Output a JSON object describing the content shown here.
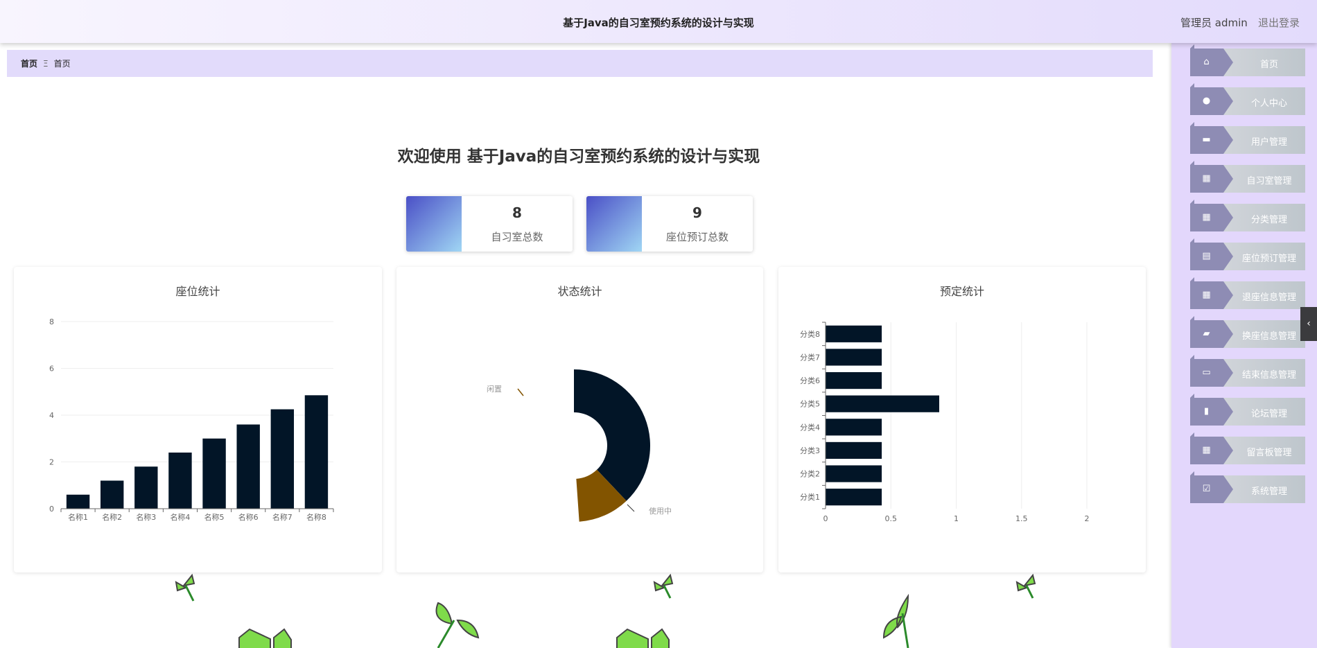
{
  "header": {
    "title": "基于Java的自习室预约系统的设计与实现",
    "user": "管理员 admin",
    "logout": "退出登录"
  },
  "breadcrumb": {
    "items": [
      "首页",
      "首页"
    ],
    "separator": "Ξ"
  },
  "welcome": "欢迎使用 基于Java的自习室预约系统的设计与实现",
  "stats": [
    {
      "value": "8",
      "label": "自习室总数"
    },
    {
      "value": "9",
      "label": "座位预订总数"
    }
  ],
  "sidebar": {
    "items": [
      {
        "label": "首页",
        "icon": "home-icon"
      },
      {
        "label": "个人中心",
        "icon": "user-icon"
      },
      {
        "label": "用户管理",
        "icon": "briefcase-icon"
      },
      {
        "label": "自习室管理",
        "icon": "grid-icon"
      },
      {
        "label": "分类管理",
        "icon": "grid-icon"
      },
      {
        "label": "座位预订管理",
        "icon": "clipboard-icon"
      },
      {
        "label": "退座信息管理",
        "icon": "table-icon"
      },
      {
        "label": "换座信息管理",
        "icon": "ticket-icon"
      },
      {
        "label": "结束信息管理",
        "icon": "chat-icon"
      },
      {
        "label": "论坛管理",
        "icon": "book-icon"
      },
      {
        "label": "留言板管理",
        "icon": "grid-icon"
      },
      {
        "label": "系统管理",
        "icon": "checklist-icon"
      }
    ],
    "collapse": "‹"
  },
  "colors": {
    "bar": "#021527",
    "brown": "#825400",
    "accent": "#8e8cb4"
  },
  "chart_data": [
    {
      "type": "bar",
      "title": "座位统计",
      "categories": [
        "名称1",
        "名称2",
        "名称3",
        "名称4",
        "名称5",
        "名称6",
        "名称7",
        "名称8"
      ],
      "values": [
        0.6,
        1.2,
        1.8,
        2.4,
        3.0,
        3.6,
        4.25,
        4.85
      ],
      "ylim": [
        0,
        8
      ],
      "yticks": [
        "0",
        "2",
        "4",
        "6",
        "8"
      ],
      "grid": true
    },
    {
      "type": "pie",
      "title": "状态统计",
      "slices": [
        {
          "name": "使用中",
          "value": 38
        },
        {
          "name": "闲置",
          "value": 11
        }
      ],
      "donut": true
    },
    {
      "type": "bar",
      "orientation": "horizontal",
      "title": "预定统计",
      "categories": [
        "分类1",
        "分类2",
        "分类3",
        "分类4",
        "分类5",
        "分类6",
        "分类7",
        "分类8"
      ],
      "values": [
        0.43,
        0.43,
        0.43,
        0.43,
        0.87,
        0.43,
        0.43,
        0.43
      ],
      "xlim": [
        0,
        2
      ],
      "xticks": [
        "0",
        "0.5",
        "1",
        "1.5",
        "2"
      ],
      "grid": true
    }
  ]
}
